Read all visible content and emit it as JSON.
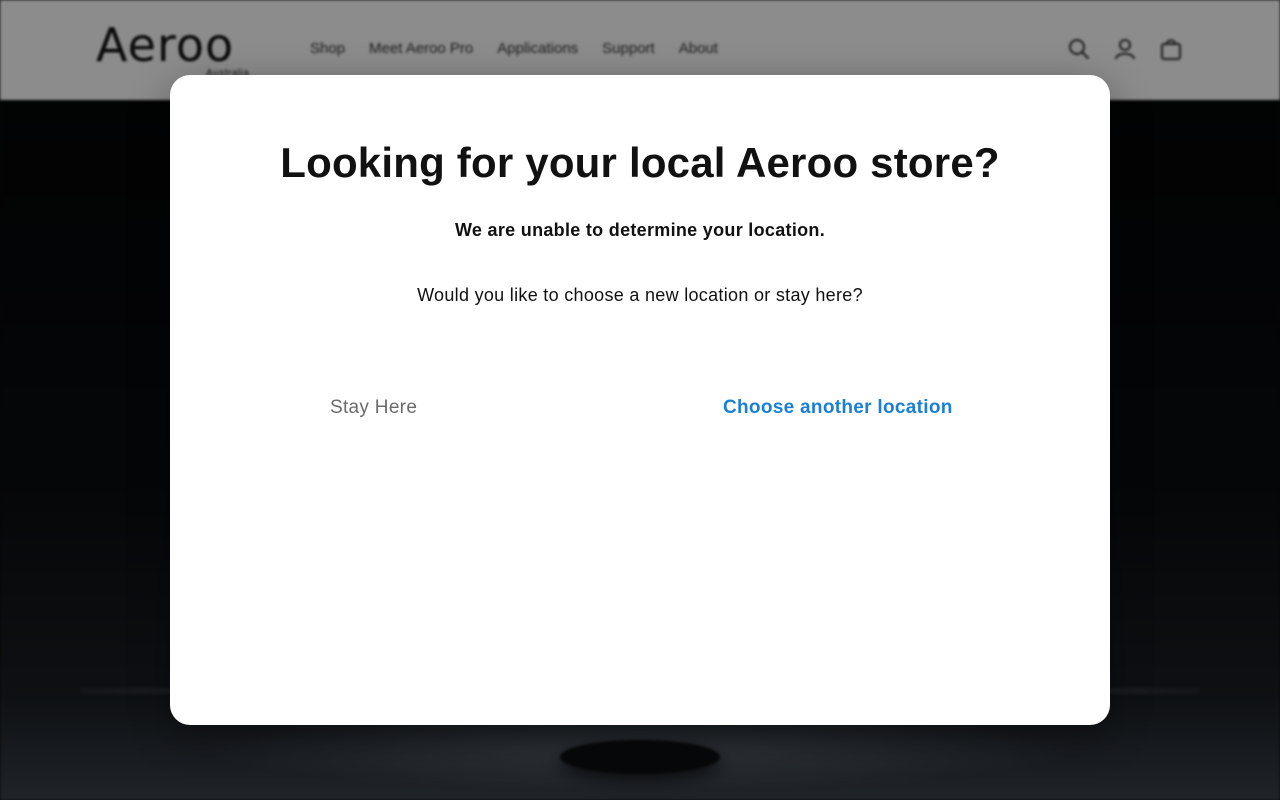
{
  "site": {
    "logo": "Aeroo",
    "logo_sub": "Australia",
    "nav": [
      {
        "label": "Shop"
      },
      {
        "label": "Meet Aeroo Pro"
      },
      {
        "label": "Applications"
      },
      {
        "label": "Support"
      },
      {
        "label": "About"
      }
    ],
    "icons": [
      "search-icon",
      "account-icon",
      "cart-icon"
    ]
  },
  "modal": {
    "title": "Looking for your local Aeroo store?",
    "subtitle": "We are unable to determine your location.",
    "question": "Would you like to choose a new location or stay here?",
    "stay_label": "Stay Here",
    "choose_label": "Choose another location"
  },
  "colors": {
    "accent": "#1a7fd6",
    "overlay": "#000000"
  }
}
